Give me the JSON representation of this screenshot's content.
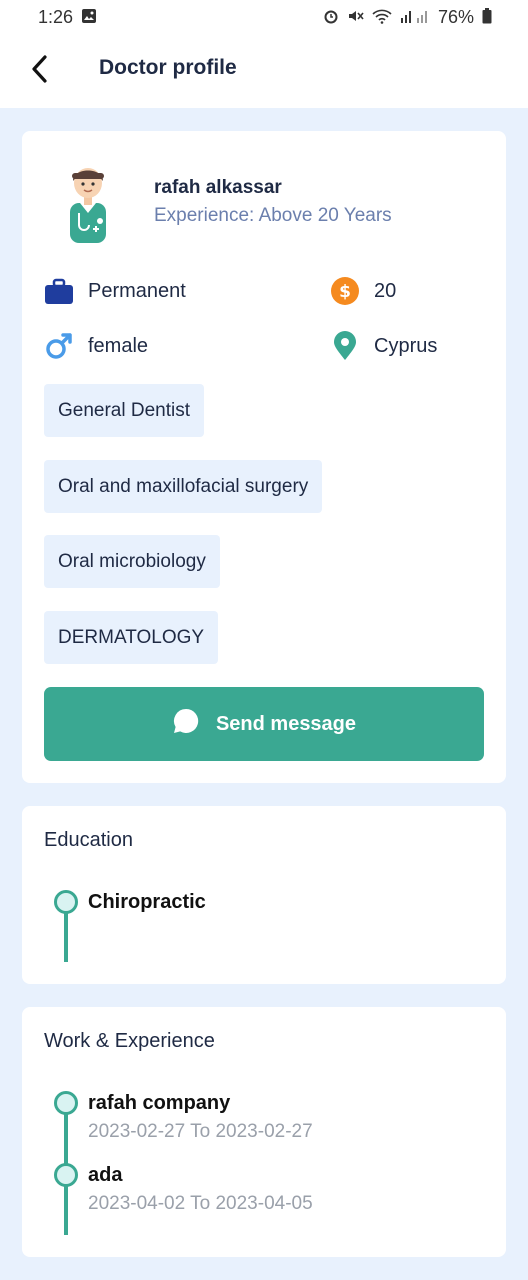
{
  "status_bar": {
    "time": "1:26",
    "battery": "76%"
  },
  "header": {
    "title": "Doctor profile"
  },
  "doctor": {
    "name": "rafah alkassar",
    "experience": "Experience: Above 20 Years",
    "employment_type": "Permanent",
    "rate": "20",
    "gender": "female",
    "location": "Cyprus"
  },
  "specialties": [
    "General Dentist",
    "Oral and maxillofacial surgery",
    "Oral microbiology",
    "DERMATOLOGY"
  ],
  "actions": {
    "send_message_label": "Send message"
  },
  "education": {
    "title": "Education",
    "items": [
      {
        "title": "Chiropractic"
      }
    ]
  },
  "work": {
    "title": "Work & Experience",
    "items": [
      {
        "title": "rafah company",
        "dates": "2023-02-27 To 2023-02-27"
      },
      {
        "title": "ada",
        "dates": "2023-04-02 To 2023-04-05"
      }
    ]
  },
  "colors": {
    "accent": "#3aa892",
    "background": "#e8f1fd",
    "chip": "#e8f1fd",
    "muted": "#6b7fad",
    "coin": "#f58a1f",
    "briefcase": "#1f3d9e"
  },
  "icons": [
    "gallery-icon",
    "alarm-icon",
    "mute-icon",
    "wifi-icon",
    "signal-icon",
    "battery-icon",
    "back-arrow-icon",
    "doctor-avatar",
    "briefcase-icon",
    "dollar-coin-icon",
    "male-gender-icon",
    "location-pin-icon",
    "chat-bubble-icon"
  ]
}
